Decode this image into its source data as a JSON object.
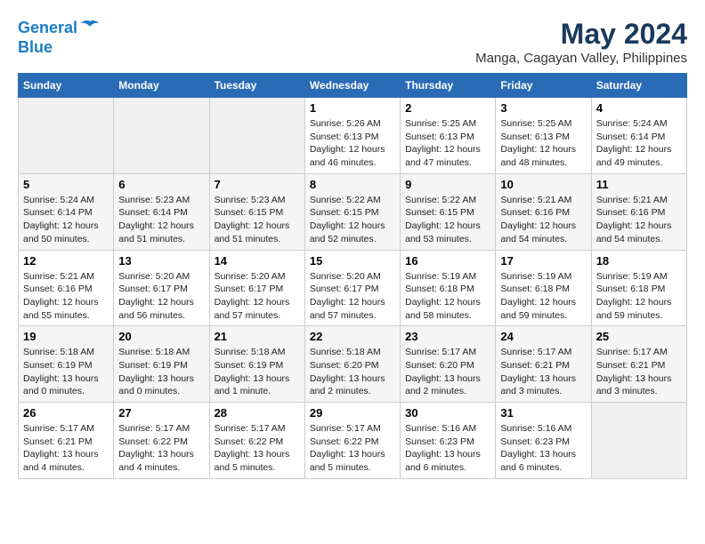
{
  "header": {
    "logo_line1": "General",
    "logo_line2": "Blue",
    "title": "May 2024",
    "subtitle": "Manga, Cagayan Valley, Philippines"
  },
  "weekdays": [
    "Sunday",
    "Monday",
    "Tuesday",
    "Wednesday",
    "Thursday",
    "Friday",
    "Saturday"
  ],
  "weeks": [
    [
      {
        "day": "",
        "info": ""
      },
      {
        "day": "",
        "info": ""
      },
      {
        "day": "",
        "info": ""
      },
      {
        "day": "1",
        "info": "Sunrise: 5:26 AM\nSunset: 6:13 PM\nDaylight: 12 hours and 46 minutes."
      },
      {
        "day": "2",
        "info": "Sunrise: 5:25 AM\nSunset: 6:13 PM\nDaylight: 12 hours and 47 minutes."
      },
      {
        "day": "3",
        "info": "Sunrise: 5:25 AM\nSunset: 6:13 PM\nDaylight: 12 hours and 48 minutes."
      },
      {
        "day": "4",
        "info": "Sunrise: 5:24 AM\nSunset: 6:14 PM\nDaylight: 12 hours and 49 minutes."
      }
    ],
    [
      {
        "day": "5",
        "info": "Sunrise: 5:24 AM\nSunset: 6:14 PM\nDaylight: 12 hours and 50 minutes."
      },
      {
        "day": "6",
        "info": "Sunrise: 5:23 AM\nSunset: 6:14 PM\nDaylight: 12 hours and 51 minutes."
      },
      {
        "day": "7",
        "info": "Sunrise: 5:23 AM\nSunset: 6:15 PM\nDaylight: 12 hours and 51 minutes."
      },
      {
        "day": "8",
        "info": "Sunrise: 5:22 AM\nSunset: 6:15 PM\nDaylight: 12 hours and 52 minutes."
      },
      {
        "day": "9",
        "info": "Sunrise: 5:22 AM\nSunset: 6:15 PM\nDaylight: 12 hours and 53 minutes."
      },
      {
        "day": "10",
        "info": "Sunrise: 5:21 AM\nSunset: 6:16 PM\nDaylight: 12 hours and 54 minutes."
      },
      {
        "day": "11",
        "info": "Sunrise: 5:21 AM\nSunset: 6:16 PM\nDaylight: 12 hours and 54 minutes."
      }
    ],
    [
      {
        "day": "12",
        "info": "Sunrise: 5:21 AM\nSunset: 6:16 PM\nDaylight: 12 hours and 55 minutes."
      },
      {
        "day": "13",
        "info": "Sunrise: 5:20 AM\nSunset: 6:17 PM\nDaylight: 12 hours and 56 minutes."
      },
      {
        "day": "14",
        "info": "Sunrise: 5:20 AM\nSunset: 6:17 PM\nDaylight: 12 hours and 57 minutes."
      },
      {
        "day": "15",
        "info": "Sunrise: 5:20 AM\nSunset: 6:17 PM\nDaylight: 12 hours and 57 minutes."
      },
      {
        "day": "16",
        "info": "Sunrise: 5:19 AM\nSunset: 6:18 PM\nDaylight: 12 hours and 58 minutes."
      },
      {
        "day": "17",
        "info": "Sunrise: 5:19 AM\nSunset: 6:18 PM\nDaylight: 12 hours and 59 minutes."
      },
      {
        "day": "18",
        "info": "Sunrise: 5:19 AM\nSunset: 6:18 PM\nDaylight: 12 hours and 59 minutes."
      }
    ],
    [
      {
        "day": "19",
        "info": "Sunrise: 5:18 AM\nSunset: 6:19 PM\nDaylight: 13 hours and 0 minutes."
      },
      {
        "day": "20",
        "info": "Sunrise: 5:18 AM\nSunset: 6:19 PM\nDaylight: 13 hours and 0 minutes."
      },
      {
        "day": "21",
        "info": "Sunrise: 5:18 AM\nSunset: 6:19 PM\nDaylight: 13 hours and 1 minute."
      },
      {
        "day": "22",
        "info": "Sunrise: 5:18 AM\nSunset: 6:20 PM\nDaylight: 13 hours and 2 minutes."
      },
      {
        "day": "23",
        "info": "Sunrise: 5:17 AM\nSunset: 6:20 PM\nDaylight: 13 hours and 2 minutes."
      },
      {
        "day": "24",
        "info": "Sunrise: 5:17 AM\nSunset: 6:21 PM\nDaylight: 13 hours and 3 minutes."
      },
      {
        "day": "25",
        "info": "Sunrise: 5:17 AM\nSunset: 6:21 PM\nDaylight: 13 hours and 3 minutes."
      }
    ],
    [
      {
        "day": "26",
        "info": "Sunrise: 5:17 AM\nSunset: 6:21 PM\nDaylight: 13 hours and 4 minutes."
      },
      {
        "day": "27",
        "info": "Sunrise: 5:17 AM\nSunset: 6:22 PM\nDaylight: 13 hours and 4 minutes."
      },
      {
        "day": "28",
        "info": "Sunrise: 5:17 AM\nSunset: 6:22 PM\nDaylight: 13 hours and 5 minutes."
      },
      {
        "day": "29",
        "info": "Sunrise: 5:17 AM\nSunset: 6:22 PM\nDaylight: 13 hours and 5 minutes."
      },
      {
        "day": "30",
        "info": "Sunrise: 5:16 AM\nSunset: 6:23 PM\nDaylight: 13 hours and 6 minutes."
      },
      {
        "day": "31",
        "info": "Sunrise: 5:16 AM\nSunset: 6:23 PM\nDaylight: 13 hours and 6 minutes."
      },
      {
        "day": "",
        "info": ""
      }
    ]
  ]
}
